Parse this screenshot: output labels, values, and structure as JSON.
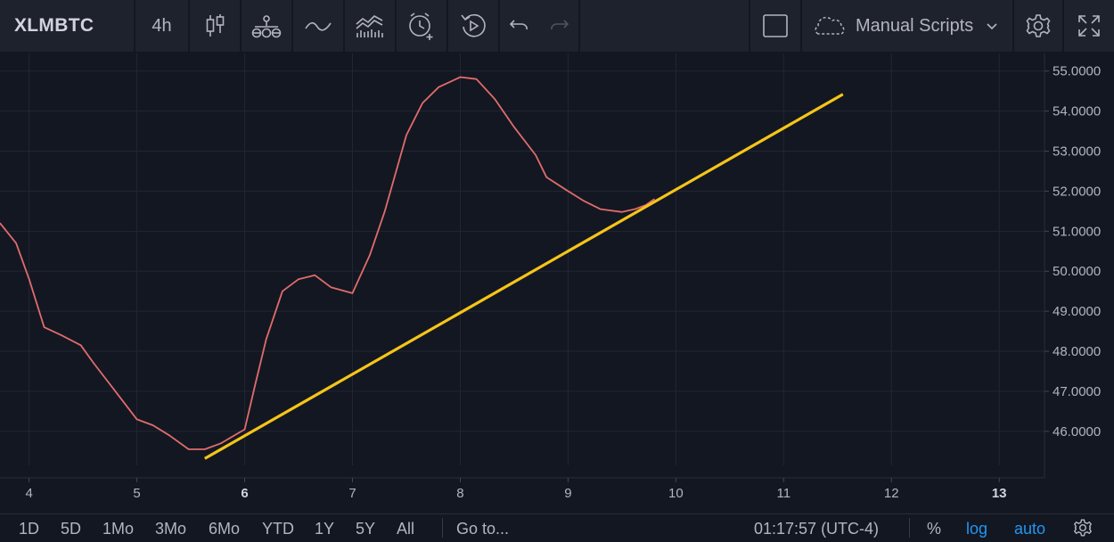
{
  "toolbar": {
    "symbol": "XLMBTC",
    "interval": "4h",
    "icons": [
      "candles-icon",
      "indicators-icon",
      "line-icon",
      "compare-icon",
      "alert-icon",
      "replay-icon",
      "undo-icon",
      "redo-icon"
    ],
    "layout_icon": "square-icon",
    "scripts_label": "Manual Scripts",
    "settings_icon": "gear-icon",
    "fullscreen_icon": "fullscreen-icon"
  },
  "chart_data": {
    "type": "line",
    "series": [
      {
        "color": "#e06c6c",
        "x": [
          3.73,
          3.88,
          4.0,
          4.14,
          4.3,
          4.48,
          4.6,
          4.8,
          5.0,
          5.15,
          5.3,
          5.48,
          5.63,
          5.78,
          6.0,
          6.1,
          6.2,
          6.35,
          6.5,
          6.65,
          6.8,
          7.0,
          7.16,
          7.3,
          7.5,
          7.65,
          7.8,
          8.0,
          8.15,
          8.32,
          8.5,
          8.7,
          8.8,
          9.0,
          9.15,
          9.3,
          9.5,
          9.62,
          9.72,
          9.8
        ],
        "y": [
          51.2,
          50.7,
          49.8,
          48.6,
          48.4,
          48.15,
          47.7,
          47.0,
          46.3,
          46.15,
          45.9,
          45.55,
          45.55,
          45.7,
          46.05,
          47.2,
          48.3,
          49.5,
          49.8,
          49.9,
          49.6,
          49.45,
          50.4,
          51.5,
          53.4,
          54.2,
          54.6,
          54.85,
          54.8,
          54.3,
          53.6,
          52.9,
          52.35,
          52.0,
          51.75,
          51.55,
          51.48,
          51.55,
          51.65,
          51.8
        ]
      }
    ],
    "trendline": {
      "color": "#f5c518",
      "from": [
        5.63,
        45.32
      ],
      "to": [
        11.55,
        54.42
      ]
    },
    "ylim": [
      45.15,
      55.35
    ],
    "xlim": [
      3.73,
      13.42
    ],
    "price_ticks": [
      "55.0000",
      "54.0000",
      "53.0000",
      "52.0000",
      "51.0000",
      "50.0000",
      "49.0000",
      "48.0000",
      "47.0000",
      "46.0000"
    ],
    "price_tick_values": [
      55,
      54,
      53,
      52,
      51,
      50,
      49,
      48,
      47,
      46
    ],
    "time_ticks": [
      "4",
      "5",
      "6",
      "7",
      "8",
      "9",
      "10",
      "11",
      "12",
      "13"
    ],
    "time_tick_values": [
      4,
      5,
      6,
      7,
      8,
      9,
      10,
      11,
      12,
      13
    ],
    "time_ticks_bold": [
      "6",
      "13"
    ],
    "grid": true,
    "background": "#131722",
    "grid_color": "#232632"
  },
  "bottombar": {
    "ranges": [
      "1D",
      "5D",
      "1Mo",
      "3Mo",
      "6Mo",
      "YTD",
      "1Y",
      "5Y",
      "All"
    ],
    "goto": "Go to...",
    "clock": "01:17:57 (UTC-4)",
    "percent": "%",
    "log": "log",
    "auto": "auto",
    "settings_icon": "gear-icon"
  }
}
